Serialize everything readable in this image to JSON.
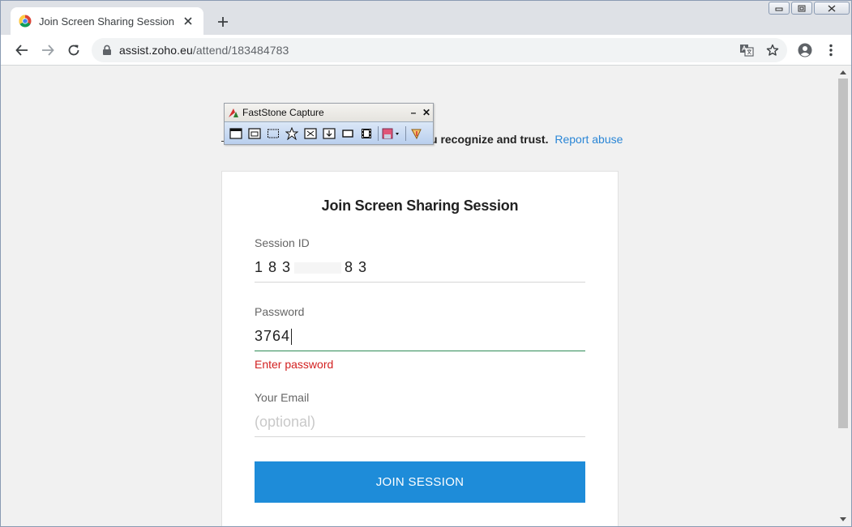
{
  "browser": {
    "tab_title": "Join Screen Sharing Session | Zoh",
    "url_host": "assist.zoho.eu",
    "url_path": "/attend/183484783"
  },
  "overlay": {
    "title": "FastStone Capture",
    "minimize": "–",
    "close": "✕"
  },
  "page": {
    "notice": "u recognize and trust.",
    "report_link": "Report abuse",
    "card": {
      "title": "Join Screen Sharing Session",
      "session_id": {
        "label": "Session ID",
        "value_start": "1 8 3",
        "value_end": "8 3"
      },
      "password": {
        "label": "Password",
        "value": "3764",
        "error": "Enter password"
      },
      "email": {
        "label": "Your Email",
        "placeholder": "(optional)",
        "value": ""
      },
      "join_label": "JOIN SESSION"
    }
  },
  "colors": {
    "accent": "#1e8cd9",
    "error": "#d21f1f",
    "focus_line": "#2e8b57",
    "link": "#2a86d6"
  }
}
